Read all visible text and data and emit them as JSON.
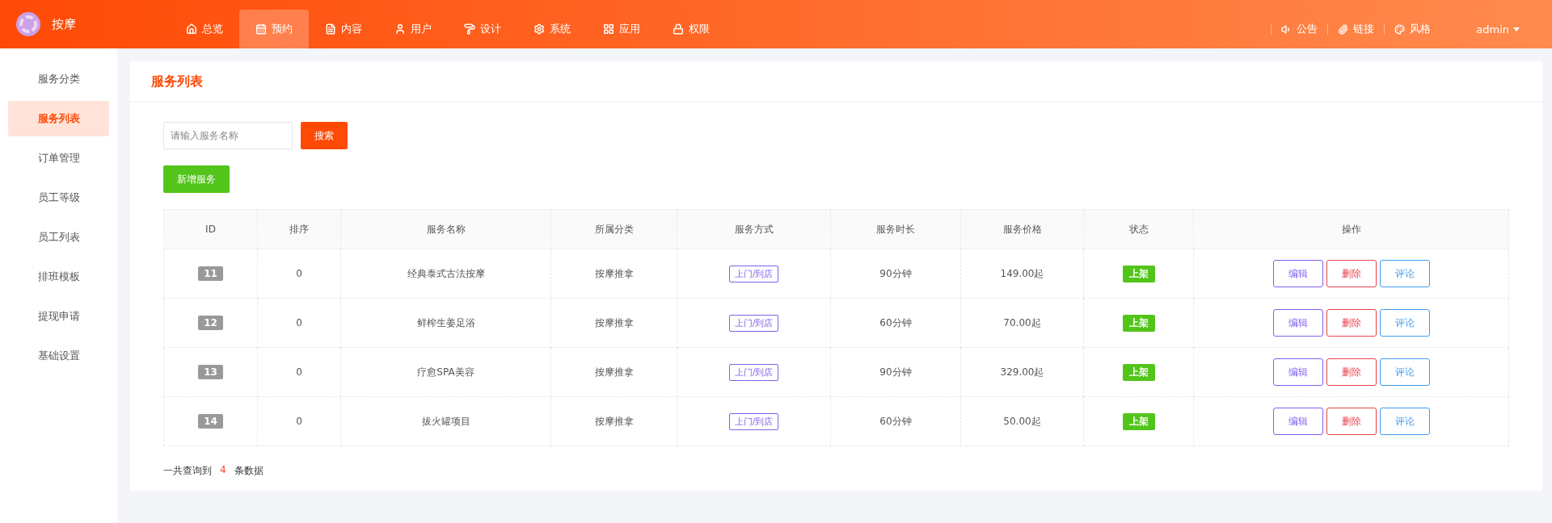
{
  "brand": {
    "name": "按摩"
  },
  "nav": [
    {
      "label": "总览",
      "selected": false
    },
    {
      "label": "预约",
      "selected": true
    },
    {
      "label": "内容",
      "selected": false
    },
    {
      "label": "用户",
      "selected": false
    },
    {
      "label": "设计",
      "selected": false
    },
    {
      "label": "系统",
      "selected": false
    },
    {
      "label": "应用",
      "selected": false
    },
    {
      "label": "权限",
      "selected": false
    }
  ],
  "header_links": [
    {
      "label": "公告"
    },
    {
      "label": "链接"
    },
    {
      "label": "风格"
    }
  ],
  "user": {
    "name": "admin"
  },
  "sidebar": {
    "items": [
      {
        "label": "服务分类",
        "selected": false
      },
      {
        "label": "服务列表",
        "selected": true
      },
      {
        "label": "订单管理",
        "selected": false
      },
      {
        "label": "员工等级",
        "selected": false
      },
      {
        "label": "员工列表",
        "selected": false
      },
      {
        "label": "排班模板",
        "selected": false
      },
      {
        "label": "提现申请",
        "selected": false
      },
      {
        "label": "基础设置",
        "selected": false
      }
    ]
  },
  "page": {
    "title": "服务列表"
  },
  "search": {
    "placeholder": "请输入服务名称",
    "button": "搜索"
  },
  "add_button": "新增服务",
  "table": {
    "columns": [
      "ID",
      "排序",
      "服务名称",
      "所属分类",
      "服务方式",
      "服务时长",
      "服务价格",
      "状态",
      "操作"
    ],
    "rows": [
      {
        "id": "11",
        "sort": "0",
        "name": "经典泰式古法按摩",
        "category": "按摩推拿",
        "mode": "上门/到店",
        "duration": "90分钟",
        "price": "149.00起",
        "status": "上架",
        "actions": [
          "编辑",
          "删除",
          "评论"
        ]
      },
      {
        "id": "12",
        "sort": "0",
        "name": "鲜榨生姜足浴",
        "category": "按摩推拿",
        "mode": "上门/到店",
        "duration": "60分钟",
        "price": "70.00起",
        "status": "上架",
        "actions": [
          "编辑",
          "删除",
          "评论"
        ]
      },
      {
        "id": "13",
        "sort": "0",
        "name": "疗愈SPA美容",
        "category": "按摩推拿",
        "mode": "上门/到店",
        "duration": "90分钟",
        "price": "329.00起",
        "status": "上架",
        "actions": [
          "编辑",
          "删除",
          "评论"
        ]
      },
      {
        "id": "14",
        "sort": "0",
        "name": "拔火罐项目",
        "category": "按摩推拿",
        "mode": "上门/到店",
        "duration": "60分钟",
        "price": "50.00起",
        "status": "上架",
        "actions": [
          "编辑",
          "删除",
          "评论"
        ]
      }
    ]
  },
  "summary": {
    "prefix": "一共查询到",
    "count": "4",
    "suffix": "条数据"
  }
}
